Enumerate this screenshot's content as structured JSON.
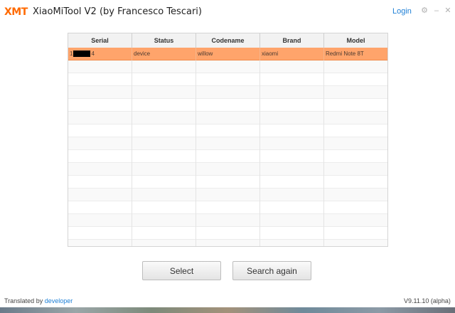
{
  "window": {
    "logo_text": "XMT",
    "title": "XiaoMiTool V2 (by Francesco Tescari)",
    "login_label": "Login",
    "gear_icon": "gear-icon",
    "minimize_icon": "minimize-icon",
    "close_icon": "close-icon"
  },
  "table": {
    "headers": [
      "Serial",
      "Status",
      "Codename",
      "Brand",
      "Model"
    ],
    "rows": [
      {
        "serial_prefix": "1",
        "serial_suffix": "4",
        "status": "device",
        "codename": "willow",
        "brand": "xiaomi",
        "model": "Redmi Note 8T",
        "selected": true
      }
    ],
    "selected_row_color": "#ffa46b"
  },
  "buttons": {
    "select_label": "Select",
    "search_again_label": "Search again"
  },
  "footer": {
    "translated_by_label": "Translated by",
    "developer_link": "developer",
    "version": "V9.11.10 (alpha)"
  },
  "colors": {
    "accent": "#ff6a00",
    "link": "#1d7fd6"
  }
}
